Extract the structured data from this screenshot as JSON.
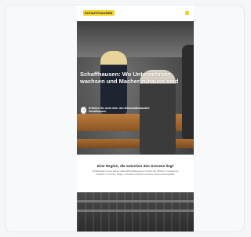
{
  "header": {
    "logo_text": "SCHAFFHAUSEN",
    "logo_color": "#f2d22b",
    "menu_icon": "menu-icon"
  },
  "hero": {
    "headline": "Schaffhausen: Wo Unternehmen wachsen und Macher zuhause sind",
    "cta_label": "Erfahren Sie mehr über den Wirtschaftsstandort Schaffhausen",
    "cta_icon": "arrow-right-icon"
  },
  "intro": {
    "title": "Eine Region, die zwischen den Grenzen liegt",
    "body": "Schaffhausen ist eine kleine, starke Wirtschaftsregion im Norden der Schweiz. Unternehmen profitieren von kurzen Wegen, innovativen Partnern und einer hohen Lebensqualität."
  }
}
